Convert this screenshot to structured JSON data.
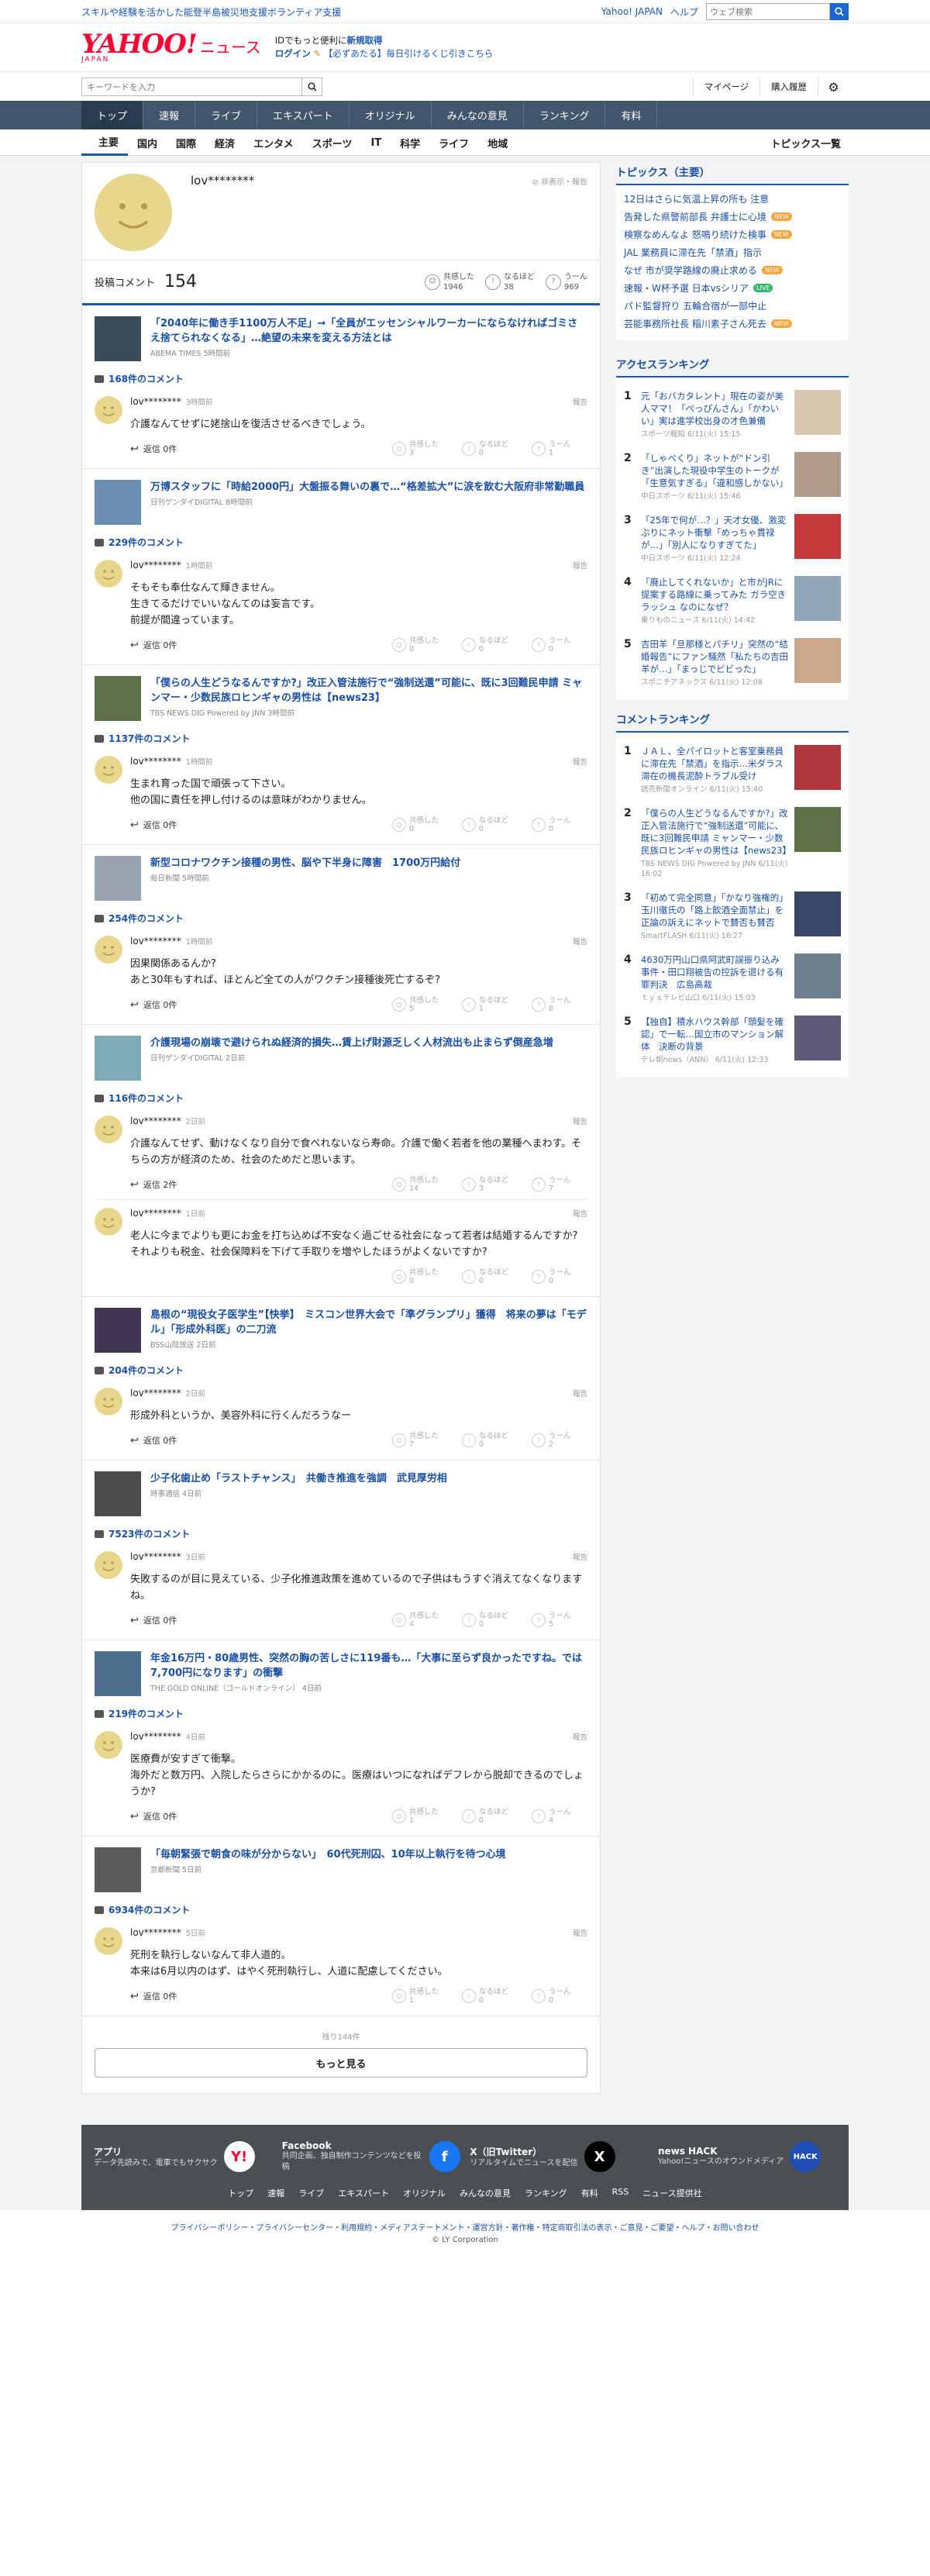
{
  "top": {
    "promo": "スキルや経験を活かした能登半島被災地支援ボランティア支援",
    "yahoo_link": "Yahoo! JAPAN",
    "help_link": "ヘルプ",
    "search_placeholder": "ウェブ検索"
  },
  "header": {
    "logo_yahoo": "YAHOO!",
    "logo_japan": "JAPAN",
    "logo_news": "ニュース",
    "id_line1_text": "IDでもっと便利に",
    "id_line1_link": "新規取得",
    "id_line2_link": "ログイン",
    "id_line2_text": "【必ずあたる】毎日引けるくじ引きこちら"
  },
  "search": {
    "placeholder": "キーワードを入力",
    "mypage": "マイページ",
    "purchase": "購入履歴"
  },
  "nav": {
    "tabs": [
      "トップ",
      "速報",
      "ライブ",
      "エキスパート",
      "オリジナル",
      "みんなの意見",
      "ランキング",
      "有料"
    ]
  },
  "subnav": {
    "items": [
      "主要",
      "国内",
      "国際",
      "経済",
      "エンタメ",
      "スポーツ",
      "IT",
      "科学",
      "ライフ",
      "地域"
    ],
    "topics_list": "トピックス一覧"
  },
  "profile": {
    "username": "lov********",
    "menu": "非表示・報告",
    "comments_label": "投稿コメント",
    "comments_count": "154",
    "empathy_label": "共感した",
    "empathy_count": "1946",
    "naruhodo_label": "なるほど",
    "naruhodo_count": "38",
    "uun_label": "うーん",
    "uun_count": "969"
  },
  "labels": {
    "reply": "返信",
    "report": "報告",
    "empathy": "共感した",
    "naruhodo": "なるほど",
    "uun": "うーん"
  },
  "articles": [
    {
      "title": "「2040年に働き手1100万人不足」→「全員がエッセンシャルワーカーにならなければゴミさえ捨てられなくなる」…絶望の未来を変える方法とは",
      "source": "ABEMA TIMES 5時間前",
      "comment_count": "168件のコメント",
      "thumb": "#3a4b5c",
      "comments": [
        {
          "user": "lov********",
          "time": "3時間前",
          "text": "介護なんてせずに姥捨山を復活させるべきでしょう。",
          "reply": "0件",
          "empathy": "3",
          "naruhodo": "0",
          "uun": "1"
        }
      ]
    },
    {
      "title": "万博スタッフに「時給2000円」大盤振る舞いの裏で…“格差拡大”に涙を飲む大阪府非常勤職員",
      "source": "日刊ゲンダイDIGITAL 8時間前",
      "comment_count": "229件のコメント",
      "thumb": "#6c8fb0",
      "comments": [
        {
          "user": "lov********",
          "time": "1時間前",
          "text": "そもそも奉仕なんて輝きません。\n生きてるだけでいいなんてのは妄言です。\n前提が間違っています。",
          "reply": "0件",
          "empathy": "0",
          "naruhodo": "0",
          "uun": "0"
        }
      ]
    },
    {
      "title": "「僕らの人生どうなるんですか?」改正入管法施行で“強制送還”可能に、既に3回難民申請 ミャンマー・少数民族ロヒンギャの男性は【news23】",
      "source": "TBS NEWS DIG Powered by JNN 3時間前",
      "comment_count": "1137件のコメント",
      "thumb": "#5e7047",
      "comments": [
        {
          "user": "lov********",
          "time": "1時間前",
          "text": "生まれ育った国で頑張って下さい。\n他の国に責任を押し付けるのは意味がわかりません。",
          "reply": "0件",
          "empathy": "0",
          "naruhodo": "0",
          "uun": "0"
        }
      ]
    },
    {
      "title": "新型コロナワクチン接種の男性、脳や下半身に障害　1700万円給付",
      "source": "毎日新聞 5時間前",
      "comment_count": "254件のコメント",
      "thumb": "#9aa4b0",
      "comments": [
        {
          "user": "lov********",
          "time": "1時間前",
          "text": "因果関係あるんか?\nあと30年もすれば、ほとんど全ての人がワクチン接種後死亡するぞ?",
          "reply": "0件",
          "empathy": "5",
          "naruhodo": "1",
          "uun": "8"
        }
      ]
    },
    {
      "title": "介護現場の崩壊で避けられぬ経済的損失…賃上げ財源乏しく人材流出も止まらず倒産急増",
      "source": "日刊ゲンダイDIGITAL 2日前",
      "comment_count": "116件のコメント",
      "thumb": "#7fa9b5",
      "comments": [
        {
          "user": "lov********",
          "time": "2日前",
          "text": "介護なんてせず、動けなくなり自分で食べれないなら寿命。介護で働く若者を他の業種へまわす。そちらの方が経済のため、社会のためだと思います。",
          "reply": "2件",
          "empathy": "14",
          "naruhodo": "3",
          "uun": "7"
        },
        {
          "user": "lov********",
          "time": "1日前",
          "text": "老人に今までよりも更にお金を打ち込めば不安なく過ごせる社会になって若者は結婚するんですか?\nそれよりも税金、社会保障料を下げて手取りを増やしたほうがよくないですか?",
          "reply": "",
          "empathy": "0",
          "naruhodo": "0",
          "uun": "0"
        }
      ]
    },
    {
      "title": "島根の“現役女子医学生”【快挙】　ミスコン世界大会で「準グランプリ」獲得　将来の夢は「モデル」「形成外科医」の二刀流",
      "source": "BSS山陰放送 2日前",
      "comment_count": "204件のコメント",
      "thumb": "#3e3650",
      "comments": [
        {
          "user": "lov********",
          "time": "2日前",
          "text": "形成外科というか、美容外科に行くんだろうなー",
          "reply": "0件",
          "empathy": "7",
          "naruhodo": "0",
          "uun": "2"
        }
      ]
    },
    {
      "title": "少子化歯止め「ラストチャンス」　共働き推進を強調　武見厚労相",
      "source": "時事通信 4日前",
      "comment_count": "7523件のコメント",
      "thumb": "#4c4c4c",
      "comments": [
        {
          "user": "lov********",
          "time": "3日前",
          "text": "失敗するのが目に見えている、少子化推進政策を進めているので子供はもうすぐ消えてなくなりますね。",
          "reply": "0件",
          "empathy": "4",
          "naruhodo": "0",
          "uun": "5"
        }
      ]
    },
    {
      "title": "年金16万円・80歳男性、突然の胸の苦しさに119番も…「大事に至らず良かったですね。では7,700円になります」の衝撃",
      "source": "THE GOLD ONLINE（ゴールドオンライン） 4日前",
      "comment_count": "219件のコメント",
      "thumb": "#4f6f8f",
      "comments": [
        {
          "user": "lov********",
          "time": "4日前",
          "text": "医療費が安すぎて衝撃。\n海外だと数万円、入院したらさらにかかるのに。医療はいつになればデフレから脱却できるのでしょうか?",
          "reply": "0件",
          "empathy": "1",
          "naruhodo": "0",
          "uun": "4"
        }
      ]
    },
    {
      "title": "「毎朝緊張で朝食の味が分からない」　60代死刑囚、10年以上執行を待つ心境",
      "source": "京都新聞 5日前",
      "comment_count": "6934件のコメント",
      "thumb": "#5a5a5a",
      "comments": [
        {
          "user": "lov********",
          "time": "5日前",
          "text": "死刑を執行しないなんて非人道的。\n本来は6月以内のはず、はやく死刑執行し、人道に配慮してください。",
          "reply": "0件",
          "empathy": "1",
          "naruhodo": "0",
          "uun": "0"
        }
      ]
    }
  ],
  "more": {
    "remaining": "残り144件",
    "button": "もっと見る"
  },
  "sidebar": {
    "topics_title": "トピックス（主要）",
    "topics": [
      {
        "text": "12日はさらに気温上昇の所も 注意",
        "badge": ""
      },
      {
        "text": "告発した県警前部長 弁護士に心境",
        "badge": "NEW"
      },
      {
        "text": "検察なめんなよ 怒鳴り続けた検事",
        "badge": "NEW"
      },
      {
        "text": "JAL 業務員に滞在先「禁酒」指示",
        "badge": ""
      },
      {
        "text": "なぜ 市が奨学路線の廃止求める",
        "badge": "NEW"
      },
      {
        "text": "速報・W杯予選 日本vsシリア",
        "badge": "LIVE"
      },
      {
        "text": "パド監督狩り 五輪合宿が一部中止",
        "badge": ""
      },
      {
        "text": "芸能事務所社長 稲川素子さん死去",
        "badge": "NEW"
      }
    ],
    "access_title": "アクセスランキング",
    "access": [
      {
        "num": "1",
        "text": "元「おバカタレント」現在の姿が美人ママ！「ぺっぴんさん」「かわいい」実は進学校出身の才色兼備",
        "src": "スポーツ報知 6/11(火) 15:15",
        "thumb": "#d9c7b2"
      },
      {
        "num": "2",
        "text": "「しゃべくり」ネットが“ドン引き”出演した現役中学生のトークが「生意気すぎる」「違和感しかない」",
        "src": "中日スポーツ 6/11(火) 15:46",
        "thumb": "#b09a8a"
      },
      {
        "num": "3",
        "text": "「25年で何が…？」天才女優、激変ぶりにネット衝撃「めっちゃ貫禄が…」「別人になりすぎてた」",
        "src": "中日スポーツ 6/11(火) 12:24",
        "thumb": "#c43a3a"
      },
      {
        "num": "4",
        "text": "「廃止してくれないか」と市がJRに提案する路線に乗ってみた ガラ空きラッシュ なのになぜ？",
        "src": "乗りものニュース 6/11(火) 14:42",
        "thumb": "#8fa6b8"
      },
      {
        "num": "5",
        "text": "吉田羊「旦那様とパチリ」突然の“結婚報告”にファン騒然「私たちの吉田羊が…」「まっじでビビった」",
        "src": "スポニチアネックス 6/11(火) 12:08",
        "thumb": "#c9a98a"
      }
    ],
    "comment_title": "コメントランキング",
    "commentrank": [
      {
        "num": "1",
        "text": "ＪＡＬ、全パイロットと客室乗務員に滞在先「禁酒」を指示…米ダラス滞在の機長泥酔トラブル受け",
        "src": "読売新聞オンライン 6/11(火) 15:40",
        "thumb": "#b0383c"
      },
      {
        "num": "2",
        "text": "「僕らの人生どうなるんですか?」改正入管法施行で“強制送還”可能に、既に3回難民申請 ミャンマー・少数民族ロヒンギャの男性は【news23】",
        "src": "TBS NEWS DIG Powered by JNN 6/11(火) 16:02",
        "thumb": "#5e7047"
      },
      {
        "num": "3",
        "text": "「初めて完全同意」「かなり強権的」玉川徹氏の「路上飲酒全面禁止」を正論の訴えにネットで賛否も賛否",
        "src": "SmartFLASH 6/11(火) 16:27",
        "thumb": "#39466a"
      },
      {
        "num": "4",
        "text": "4630万円山口県阿武町誤振り込み事件・田口翔被告の控訴を退ける有罪判決　広島高裁",
        "src": "ｔｙｓテレビ山口 6/11(火) 15:03",
        "thumb": "#6f7f8f"
      },
      {
        "num": "5",
        "text": "【独自】積水ハウス幹部「頭髪を確認」で一転…国立市のマンション解体　決断の背景",
        "src": "テレ朝news（ANN） 6/11(火) 12:33",
        "thumb": "#5d5a7a"
      }
    ]
  },
  "footer": {
    "apps": [
      {
        "title": "アプリ",
        "desc": "データ先読みで、電車でもサクサク",
        "icon": "Y!",
        "color": "#ffffff"
      },
      {
        "title": "Facebook",
        "desc": "共同企画、独自制作コンテンツなどを投稿",
        "icon": "f",
        "color": "#1877f2"
      },
      {
        "title": "X（旧Twitter）",
        "desc": "リアルタイムでニュースを配信",
        "icon": "X",
        "color": "#000000"
      },
      {
        "title": "news HACK",
        "desc": "Yahoo!ニュースのオウンドメディア",
        "icon": "HACK",
        "color": "#1f4fb6"
      }
    ],
    "nav": [
      "トップ",
      "速報",
      "ライブ",
      "エキスパート",
      "オリジナル",
      "みんなの意見",
      "ランキング",
      "有料",
      "RSS",
      "ニュース提供社"
    ],
    "legal": "プライバシーポリシー・プライバシーセンター・利用規約・メディアステートメント・運営方針・著作権・特定商取引法の表示・ご意見・ご要望・ヘルプ・お問い合わせ",
    "copyright": "© LY Corporation"
  }
}
